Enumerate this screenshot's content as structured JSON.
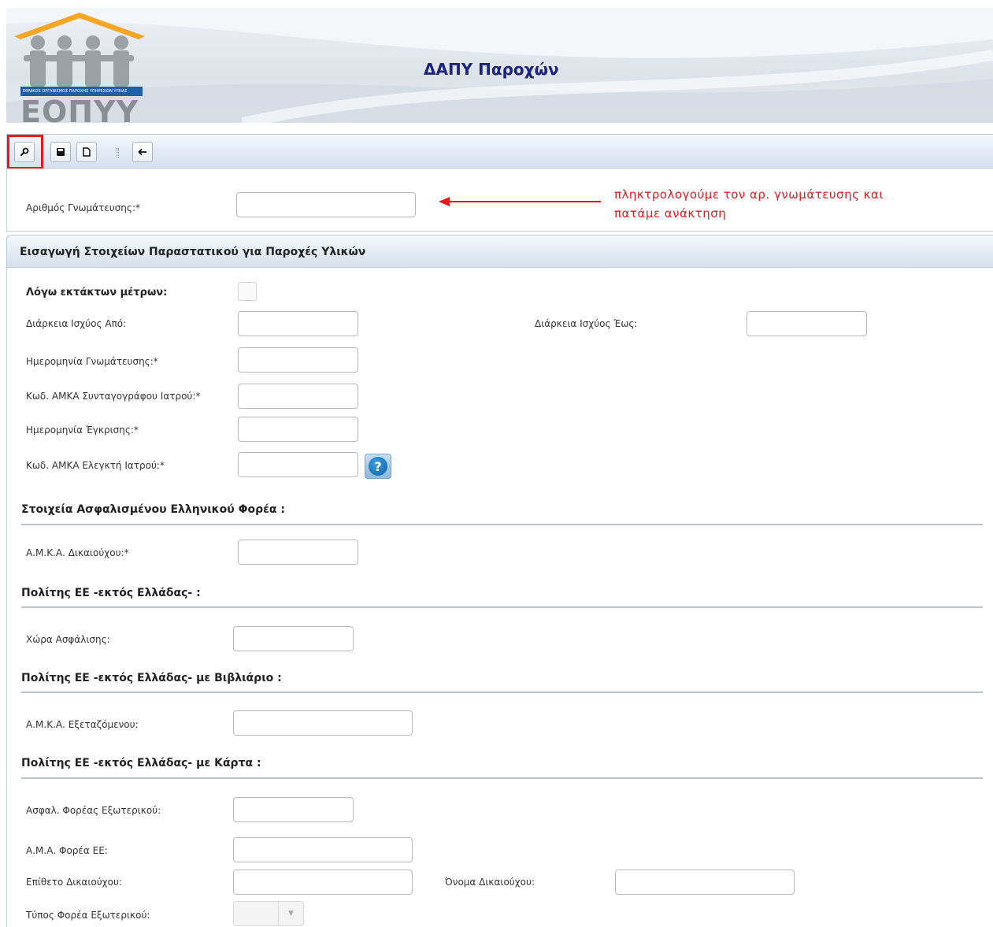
{
  "header": {
    "title": "ΔΑΠΥ Παροχών",
    "logo_text": "ΕΟΠΥΥ",
    "logo_band": "ΕΘΝΙΚΟΣ ΟΡΓΑΝΙΣΜΟΣ ΠΑΡΟΧΗΣ ΥΠΗΡΕΣΙΩΝ ΥΓΕΙΑΣ"
  },
  "toolbar": {
    "buttons": [
      {
        "name": "retrieve",
        "icon": "link-icon"
      },
      {
        "name": "save",
        "icon": "save-icon"
      },
      {
        "name": "new",
        "icon": "new-document-icon"
      },
      {
        "name": "back",
        "icon": "arrow-left-icon"
      }
    ],
    "highlight_color": "#e8191e"
  },
  "top_form": {
    "referral_number_label": "Αριθμός Γνωμάτευσης:*",
    "referral_number_value": ""
  },
  "annotation": {
    "line1": "πληκτρολογούμε τον αρ. γνωμάτευσης και",
    "line2": "πατάμε ανάκτηση",
    "color": "#e8191e"
  },
  "main_section": {
    "title": "Εισαγωγή Στοιχείων Παραστατικού για Παροχές Υλικών",
    "emergency_label": "Λόγω εκτάκτων μέτρων:",
    "emergency_checked": false,
    "valid_from_label": "Διάρκεια Ισχύος Από:",
    "valid_to_label": "Διάρκεια Ισχύος Έως:",
    "referral_date_label": "Ημερομηνία Γνωμάτευσης:*",
    "prescriber_amka_label": "Κωδ. ΑΜΚΑ Συνταγογράφου Ιατρού:*",
    "approval_date_label": "Ημερομηνία Έγκρισης:*",
    "auditor_amka_label": "Κωδ. ΑΜΚΑ Ελεγκτή Ιατρού:*",
    "help_symbol": "?"
  },
  "insured_greek": {
    "title": "Στοιχεία Ασφαλισμένου Ελληνικού Φορέα :",
    "amka_label": "Α.Μ.Κ.Α. Δικαιούχου:*"
  },
  "eu_citizen": {
    "title": "Πολίτης ΕΕ -εκτός Ελλάδας- :",
    "country_label": "Χώρα Ασφάλισης:"
  },
  "eu_booklet": {
    "title": "Πολίτης ΕΕ -εκτός Ελλάδας- με Βιβλιάριο :",
    "amka_label": "Α.Μ.Κ.Α. Εξεταζόμενου:"
  },
  "eu_card": {
    "title": "Πολίτης ΕΕ -εκτός Ελλάδας- με Κάρτα :",
    "foreign_carrier_label": "Ασφαλ. Φορέας Εξωτερικού:",
    "ama_label": "Α.Μ.Α. Φορέα ΕΕ:",
    "surname_label": "Επίθετο Δικαιούχου:",
    "name_label": "Όνομα Δικαιούχου:",
    "carrier_type_label": "Τύπος Φορέα Εξωτερικού:",
    "carrier_type_value": ""
  }
}
